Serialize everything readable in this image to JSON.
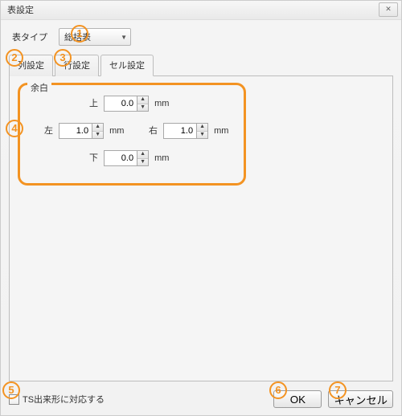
{
  "title": "表設定",
  "close_icon": "✕",
  "type_label": "表タイプ",
  "type_value": "総括表",
  "tabs": {
    "col": "列設定",
    "row": "行設定",
    "cell": "セル設定"
  },
  "group": {
    "title": "余白",
    "labels": {
      "top": "上",
      "left": "左",
      "right": "右",
      "bottom": "下"
    },
    "values": {
      "top": "0.0",
      "left": "1.0",
      "right": "1.0",
      "bottom": "0.0"
    },
    "unit": "mm"
  },
  "checkbox_label": "TS出来形に対応する",
  "buttons": {
    "ok": "OK",
    "cancel": "キャンセル"
  },
  "annotations": {
    "a1": "1",
    "a2": "2",
    "a3": "3",
    "a4": "4",
    "a5": "5",
    "a6": "6",
    "a7": "7"
  },
  "spinner": {
    "up": "▲",
    "down": "▼"
  },
  "dropdown_arrow": "▼"
}
